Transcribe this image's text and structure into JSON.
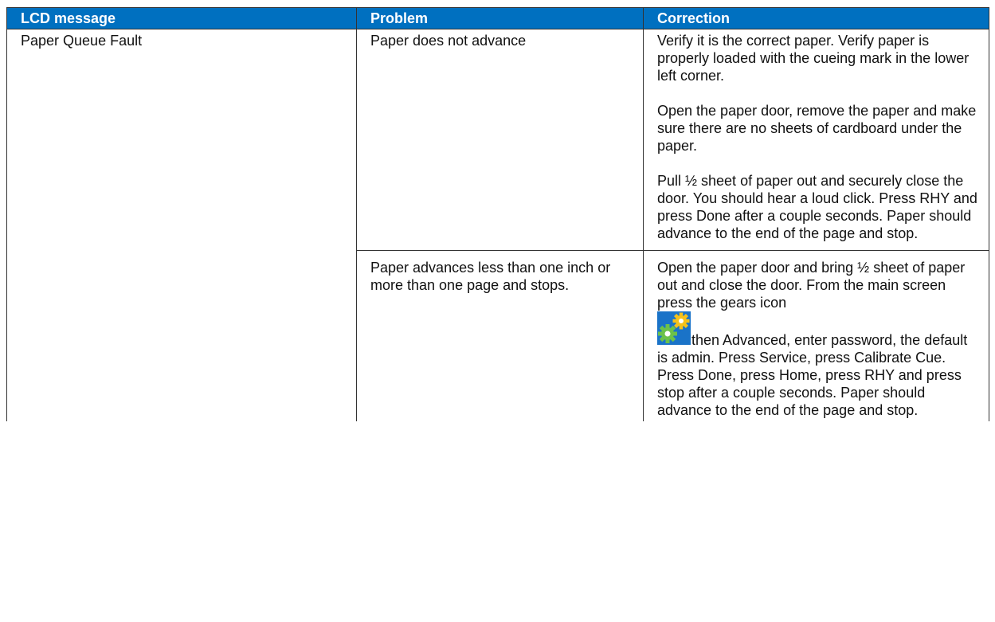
{
  "table": {
    "headers": [
      "LCD message",
      "Problem",
      "Correction"
    ],
    "rows": [
      {
        "lcd": "Paper Queue Fault",
        "problem": "Paper does not advance",
        "correction": [
          "Verify it is the correct paper. Verify paper is properly loaded with the cueing mark in the lower left corner.",
          "Open the paper door, remove the paper and make sure there are no sheets of cardboard under the paper.",
          "Pull ½ sheet of paper out and securely close the door. You should hear a loud click. Press RHY and press Done after a couple seconds. Paper should advance to the end of the page and stop."
        ]
      },
      {
        "lcd": "",
        "problem": "Paper advances less than one inch or more than one page and stops.",
        "correction_before_icon": "Open the paper door and bring ½ sheet of paper out and close the door. From the main screen press the gears icon",
        "icon": "gears-icon",
        "correction_after_icon": "then Advanced, enter password, the default is admin. Press Service, press Calibrate Cue. Press Done, press Home, press RHY and press stop after a couple seconds. Paper should advance to the end of the page and stop."
      }
    ]
  },
  "colors": {
    "header_bg": "#0070c0",
    "header_text": "#ffffff"
  }
}
